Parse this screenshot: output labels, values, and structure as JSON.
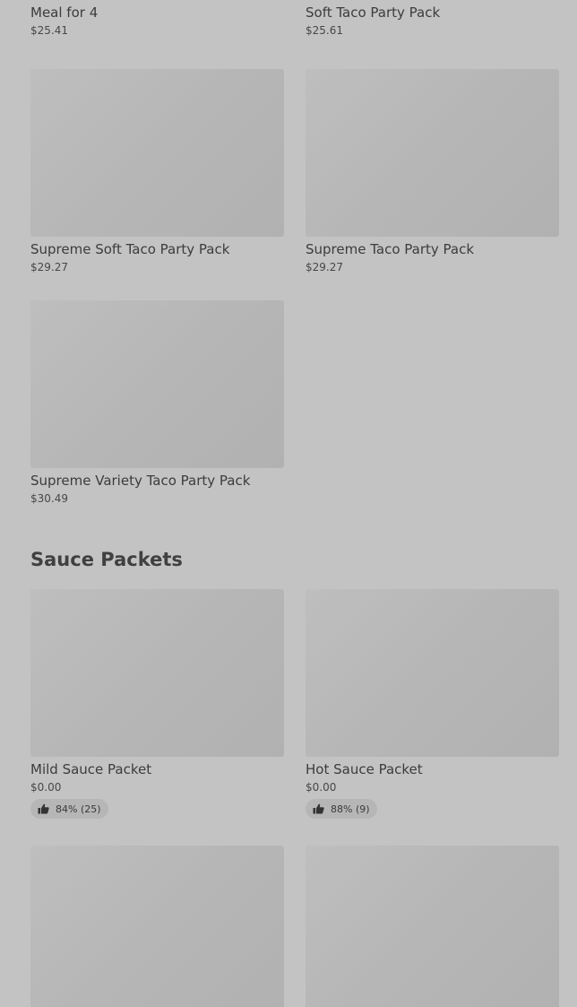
{
  "top_row": [
    {
      "name": "Meal for 4",
      "price": "$25.41"
    },
    {
      "name": "Soft Taco Party Pack",
      "price": "$25.61"
    }
  ],
  "row_2": [
    {
      "name": "Supreme Soft Taco Party Pack",
      "price": "$29.27"
    },
    {
      "name": "Supreme Taco Party Pack",
      "price": "$29.27"
    }
  ],
  "row_3": [
    {
      "name": "Supreme Variety Taco Party Pack",
      "price": "$30.49"
    }
  ],
  "sauce_section": {
    "title": "Sauce Packets",
    "items": [
      {
        "name": "Mild Sauce Packet",
        "price": "$0.00",
        "rating": "84% (25)",
        "rating_icon": "thumbs-up-icon"
      },
      {
        "name": "Hot Sauce Packet",
        "price": "$0.00",
        "rating": "88% (9)",
        "rating_icon": "thumbs-up-icon"
      }
    ]
  }
}
